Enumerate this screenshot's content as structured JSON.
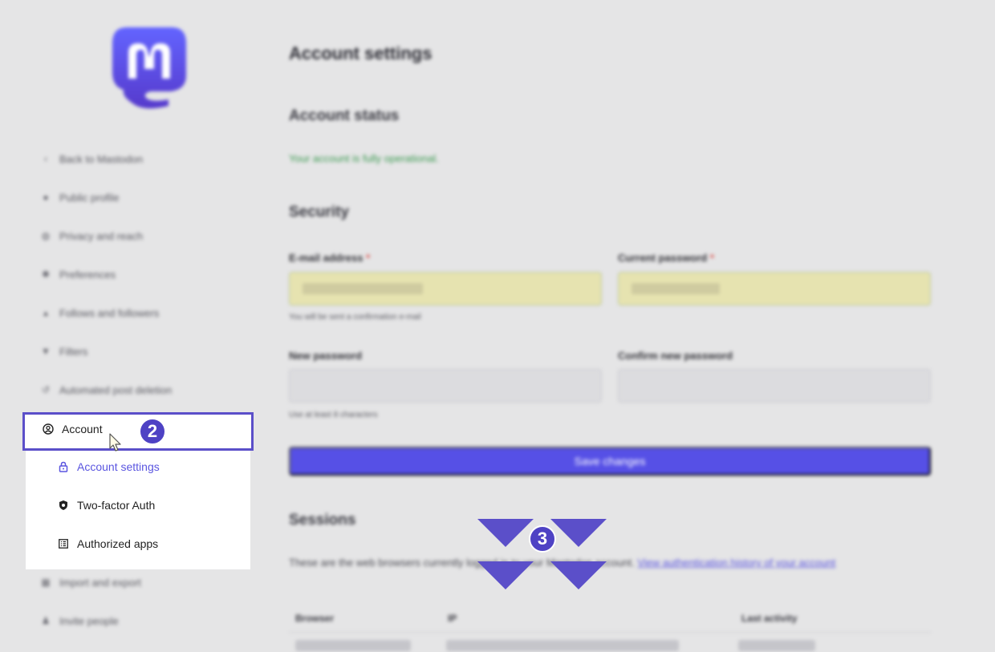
{
  "page": {
    "title": "Account settings"
  },
  "sidebar": {
    "items": [
      {
        "label": "Back to Mastodon",
        "icon": "chevron-left-icon"
      },
      {
        "label": "Public profile",
        "icon": "person-icon"
      },
      {
        "label": "Privacy and reach",
        "icon": "globe-icon"
      },
      {
        "label": "Preferences",
        "icon": "gear-icon"
      },
      {
        "label": "Follows and followers",
        "icon": "users-icon"
      },
      {
        "label": "Filters",
        "icon": "filter-icon"
      },
      {
        "label": "Automated post deletion",
        "icon": "history-icon"
      },
      {
        "label": "Import and export",
        "icon": "cloud-icon"
      },
      {
        "label": "Invite people",
        "icon": "user-plus-icon"
      }
    ],
    "account": {
      "label": "Account",
      "icon": "user-circle-icon"
    },
    "submenu": [
      {
        "label": "Account settings",
        "icon": "lock-icon",
        "active": true
      },
      {
        "label": "Two-factor Auth",
        "icon": "shield-icon",
        "active": false
      },
      {
        "label": "Authorized apps",
        "icon": "list-icon",
        "active": false
      }
    ]
  },
  "status": {
    "heading": "Account status",
    "message": "Your account is fully operational."
  },
  "security": {
    "heading": "Security",
    "email_label": "E-mail address",
    "email_hint": "You will be sent a confirmation e-mail",
    "current_password_label": "Current password",
    "new_password_label": "New password",
    "new_password_hint": "Use at least 8 characters",
    "confirm_password_label": "Confirm new password",
    "save_label": "Save changes",
    "required_mark": "*"
  },
  "sessions": {
    "heading": "Sessions",
    "description": "These are the web browsers currently logged in to your Mastodon account.",
    "history_link": "View authentication history of your account",
    "columns": [
      "Browser",
      "IP",
      "Last activity"
    ]
  },
  "annotations": {
    "step_account": "2",
    "step_sessions": "3",
    "accent_color": "#5b4fc9"
  }
}
